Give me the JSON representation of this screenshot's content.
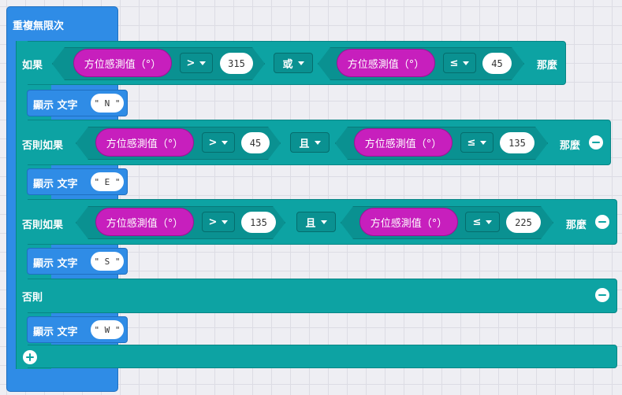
{
  "forever_label": "重複無限次",
  "sensor_label": "方位感測值（°）",
  "then_label": "那麼",
  "show_label": "顯示 文字",
  "if": {
    "keyword": "如果",
    "cond1": {
      "op": ">",
      "value": "315"
    },
    "logic": "或",
    "cond2": {
      "op": "≤",
      "value": "45"
    },
    "show_text": "\" N \""
  },
  "elif1": {
    "keyword": "否則如果",
    "cond1": {
      "op": ">",
      "value": "45"
    },
    "logic": "且",
    "cond2": {
      "op": "≤",
      "value": "135"
    },
    "show_text": "\" E \""
  },
  "elif2": {
    "keyword": "否則如果",
    "cond1": {
      "op": ">",
      "value": "135"
    },
    "logic": "且",
    "cond2": {
      "op": "≤",
      "value": "225"
    },
    "show_text": "\" S \""
  },
  "else": {
    "keyword": "否則",
    "show_text": "\" W \""
  },
  "colors": {
    "loop": "#2f8ce6",
    "logic": "#0da3a3",
    "sensor": "#c71fbd",
    "background": "#eeeef3"
  },
  "icons": {
    "remove": "minus-circle-icon",
    "add": "plus-circle-icon",
    "dropdown": "caret-down-icon"
  }
}
